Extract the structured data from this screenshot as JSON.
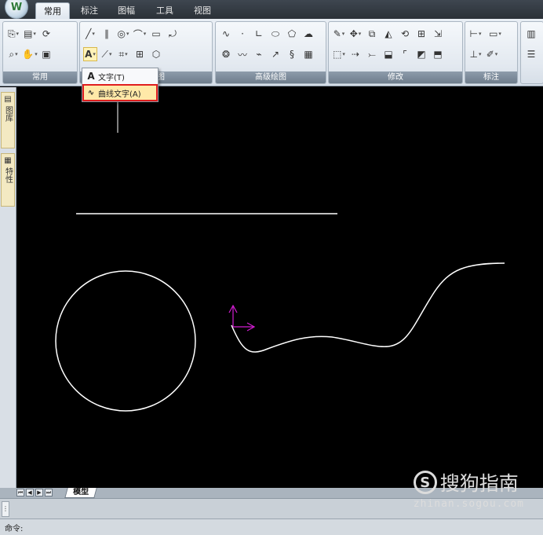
{
  "menu": {
    "tabs": [
      {
        "label": "常用",
        "active": true
      },
      {
        "label": "标注",
        "active": false
      },
      {
        "label": "图幅",
        "active": false
      },
      {
        "label": "工具",
        "active": false
      },
      {
        "label": "视图",
        "active": false
      }
    ]
  },
  "ribbon": {
    "panels": {
      "common": "常用",
      "draw": "图",
      "advanced_draw": "高级绘图",
      "modify": "修改",
      "annotate": "标注"
    }
  },
  "text_dropdown": {
    "items": [
      {
        "label": "文字(T)",
        "icon": "text-icon"
      },
      {
        "label": "曲线文字(A)",
        "icon": "curve-text-icon",
        "highlighted": true
      }
    ]
  },
  "left_palette": {
    "tabs": [
      {
        "label": "图库",
        "icon": "library-icon"
      },
      {
        "label": "特性",
        "icon": "properties-icon"
      }
    ]
  },
  "layout_tabs": {
    "active": "模型"
  },
  "command_line": {
    "prompt": "命令:"
  },
  "watermark": {
    "brand": "搜狗指南",
    "logo_letter": "S",
    "url": "zhinan.sogou.com"
  },
  "colors": {
    "canvas_bg": "#000000",
    "geometry": "#ffffff",
    "ucs_icon": "#d21dd2",
    "highlight_border": "#e01e1e"
  }
}
